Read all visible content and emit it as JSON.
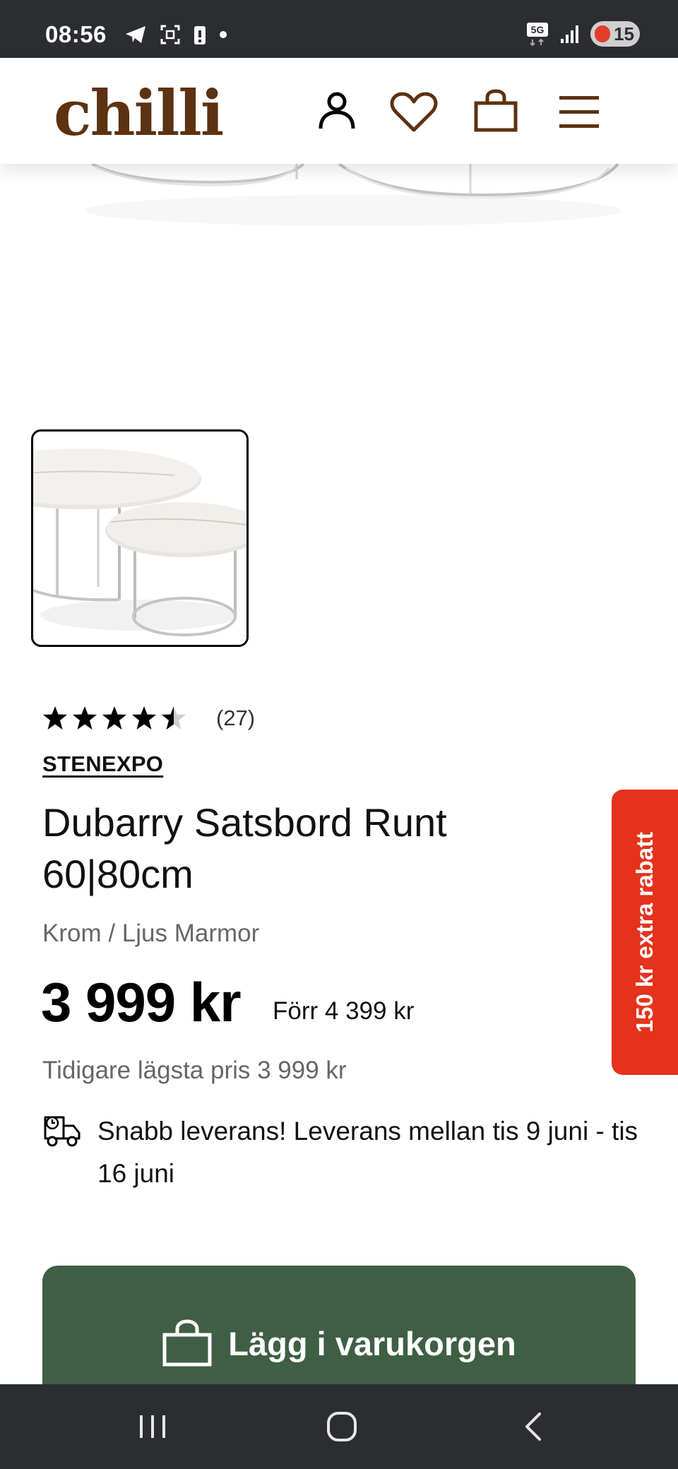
{
  "status_bar": {
    "time": "08:56",
    "network": "5G",
    "battery": "15",
    "icons": [
      "telegram-icon",
      "screenshot-icon",
      "battery-alert-icon",
      "dot-icon",
      "5g-icon",
      "signal-icon",
      "battery-icon"
    ]
  },
  "header": {
    "logo": "chilli",
    "icons": [
      "account-icon",
      "heart-icon",
      "cart-icon",
      "menu-icon"
    ],
    "brand_color": "#5b3212"
  },
  "product": {
    "rating_value": 4.5,
    "review_count": "(27)",
    "brand": "STENEXPO",
    "title": "Dubarry Satsbord Runt 60|80cm",
    "variant": "Krom / Ljus Marmor",
    "price": "3 999 kr",
    "old_price": "Förr 4 399 kr",
    "lowest_price": "Tidigare lägsta pris 3 999 kr",
    "delivery": "Snabb leverans! Leverans mellan tis 9 juni - tis 16 juni"
  },
  "cart_button": {
    "label": "Lägg i varukorgen",
    "color": "#3f5f44"
  },
  "side_tab": {
    "label": "150 kr extra rabatt",
    "color": "#e4321b"
  },
  "nav_bar": {
    "icons": [
      "recent-apps-icon",
      "home-icon",
      "back-icon"
    ]
  }
}
